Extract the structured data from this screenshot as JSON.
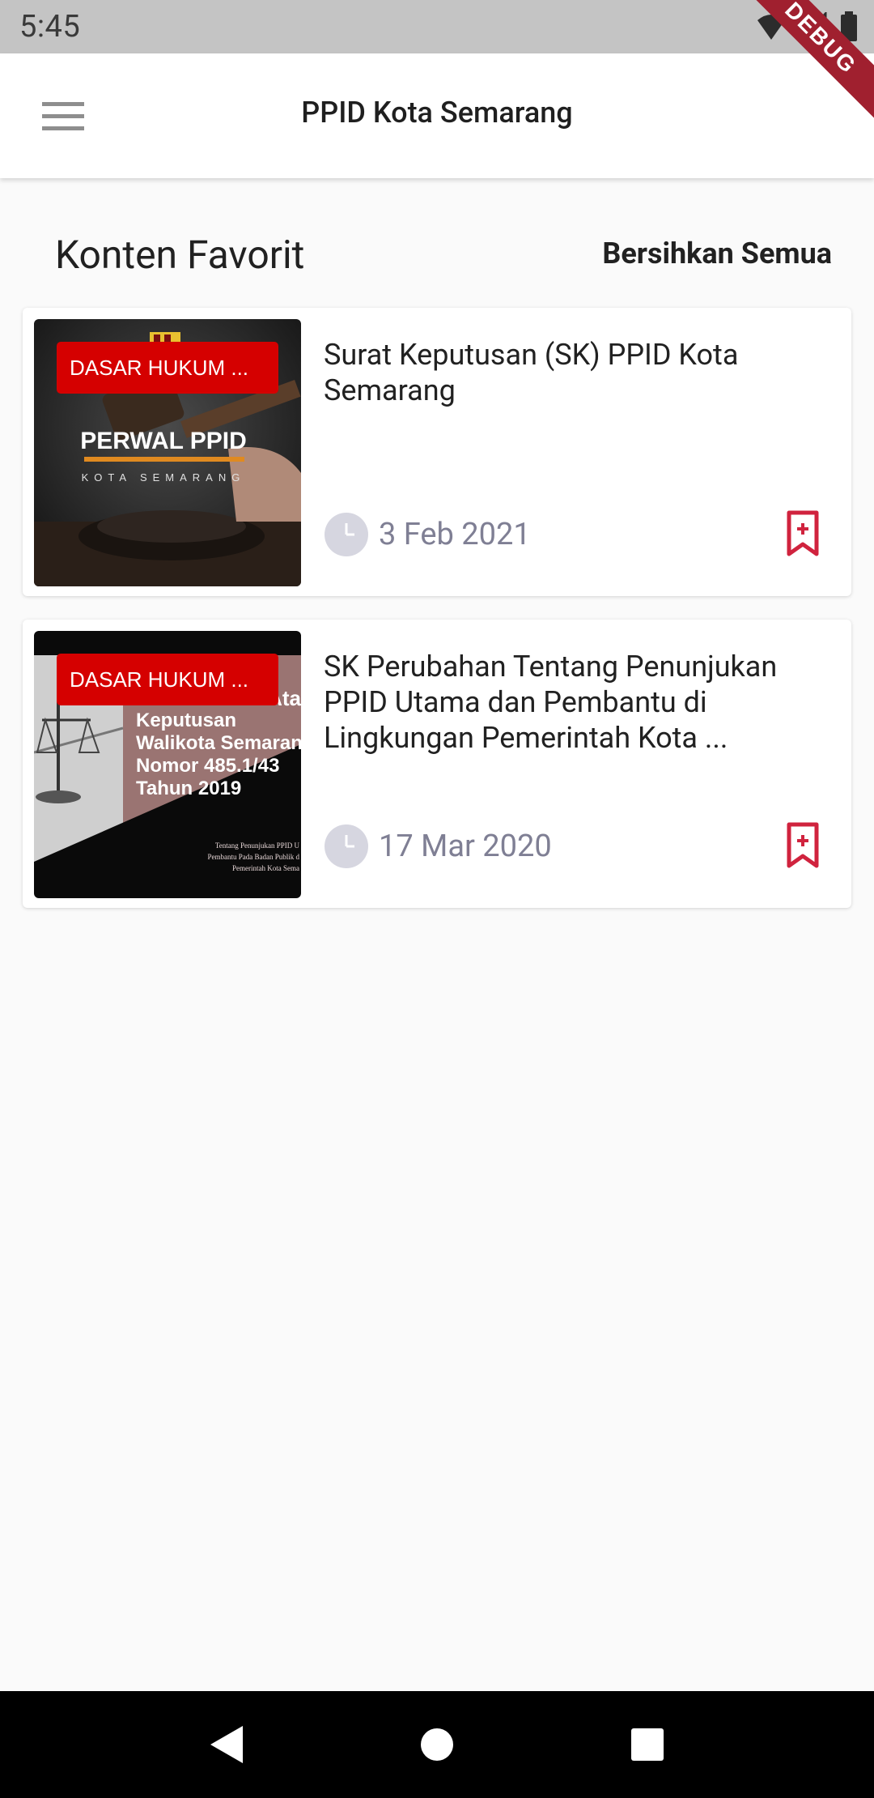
{
  "status_bar": {
    "time": "5:45",
    "icons": [
      "wifi-icon",
      "signal-icon",
      "battery-icon"
    ],
    "debug_label": "DEBUG"
  },
  "app_bar": {
    "title": "PPID Kota Semarang",
    "menu_icon": "hamburger-menu-icon"
  },
  "section": {
    "title": "Konten Favorit",
    "clear_all_label": "Bersihkan Semua"
  },
  "favorites": [
    {
      "badge": "DASAR HUKUM ...",
      "title": "Surat Keputusan (SK) PPID Kota Semarang",
      "date": "3 Feb 2021",
      "thumb_heading": "PERWAL PPID",
      "thumb_subheading": "KOTA SEMARANG"
    },
    {
      "badge": "DASAR HUKUM ...",
      "title": "SK Perubahan Tentang Penunjukan PPID Utama dan Pembantu di Lingkungan Pemerintah Kota ...",
      "date": "17 Mar 2020",
      "thumb_top": "Ata",
      "thumb_lines": [
        "Keputusan",
        "Walikota Semaran",
        "Nomor 485.1/43",
        "Tahun 2019"
      ],
      "thumb_small": [
        "Tentang Penunjukan PPID U",
        "Pembantu Pada Badan Publik d",
        "Pemerintah Kota Sema"
      ]
    }
  ],
  "nav_bar": {
    "icons": [
      "back-icon",
      "home-icon",
      "recents-icon"
    ]
  },
  "colors": {
    "badge_red": "#d50000",
    "bookmark_red": "#d0233e",
    "date_gray": "#7f7f94",
    "status_bar_bg": "#c4c4c4"
  }
}
